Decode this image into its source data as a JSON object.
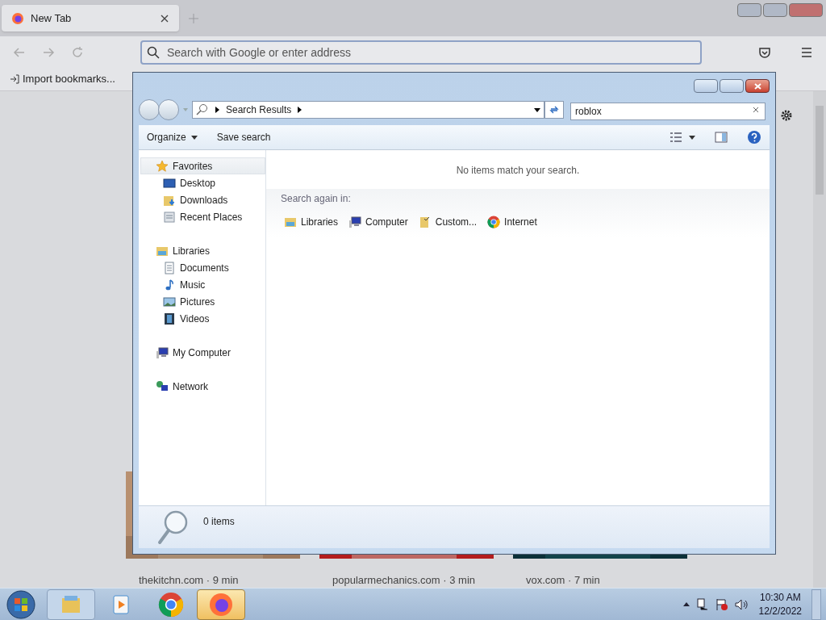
{
  "browser": {
    "tabs": [
      {
        "label": "New Tab",
        "selected": true
      }
    ],
    "address": {
      "placeholder": "Search with Google or enter address"
    },
    "bookmarks": [
      {
        "label": "Import bookmarks..."
      }
    ],
    "page": {
      "stories": [
        {
          "source": "thekitchn.com · 9 min"
        },
        {
          "source": "popularmechanics.com · 3 min"
        },
        {
          "source": "vox.com · 7 min"
        }
      ]
    }
  },
  "explorer": {
    "breadcrumb": [
      "Search Results"
    ],
    "search": {
      "value": "roblox"
    },
    "toolbar": [
      "Organize",
      "Save search"
    ],
    "nav": [
      {
        "label": "Favorites",
        "kind": "star",
        "selected": true,
        "children": [
          {
            "label": "Desktop",
            "kind": "desktop",
            "selected": false
          },
          {
            "label": "Downloads",
            "kind": "downloads",
            "selected": false
          },
          {
            "label": "Recent Places",
            "kind": "recent",
            "selected": false
          }
        ]
      },
      {
        "label": "Libraries",
        "kind": "library",
        "selected": false,
        "children": [
          {
            "label": "Documents",
            "kind": "document",
            "selected": false
          },
          {
            "label": "Music",
            "kind": "music",
            "selected": false
          },
          {
            "label": "Pictures",
            "kind": "pictures",
            "selected": false
          },
          {
            "label": "Videos",
            "kind": "videos",
            "selected": false
          }
        ]
      },
      {
        "label": "My Computer",
        "kind": "computer",
        "selected": false
      },
      {
        "label": "Network",
        "kind": "network",
        "selected": false
      }
    ],
    "message": "No items match your search.",
    "search_again": "Search again in:",
    "locations": [
      {
        "label": "Libraries",
        "kind": "library"
      },
      {
        "label": "Computer",
        "kind": "computer"
      },
      {
        "label": "Custom...",
        "kind": "custom"
      },
      {
        "label": "Internet",
        "kind": "internet"
      }
    ],
    "status": "0 items"
  },
  "taskbar": {
    "apps": [
      {
        "kind": "explorer",
        "selected": false
      },
      {
        "kind": "media",
        "selected": false
      },
      {
        "kind": "chrome",
        "selected": false
      },
      {
        "kind": "firefox",
        "selected": true
      }
    ],
    "time": "10:30 AM",
    "date": "12/2/2022"
  }
}
